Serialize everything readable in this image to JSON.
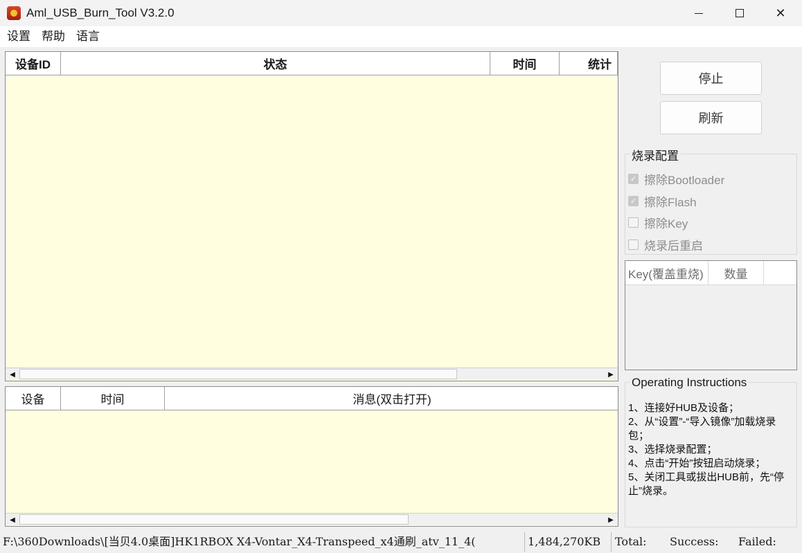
{
  "window": {
    "title": "Aml_USB_Burn_Tool V3.2.0"
  },
  "menu": {
    "items": [
      "设置",
      "帮助",
      "语言"
    ]
  },
  "device_table": {
    "columns": [
      "设备ID",
      "状态",
      "时间",
      "统计"
    ]
  },
  "message_table": {
    "columns": [
      "设备",
      "时间",
      "消息(双击打开)"
    ]
  },
  "buttons": {
    "stop": "停止",
    "refresh": "刷新"
  },
  "burn_config": {
    "title": "烧录配置",
    "options": [
      {
        "label": "擦除Bootloader",
        "checked": true
      },
      {
        "label": "擦除Flash",
        "checked": true
      },
      {
        "label": "擦除Key",
        "checked": false
      },
      {
        "label": "烧录后重启",
        "checked": false
      }
    ]
  },
  "key_table": {
    "columns": [
      "Key(覆盖重烧)",
      "数量"
    ]
  },
  "instructions": {
    "title": "Operating Instructions",
    "text": "1、连接好HUB及设备；\n2、从“设置”-“导入镜像”加载烧录包；\n3、选择烧录配置；\n4、点击“开始”按钮启动烧录；\n5、关闭工具或拔出HUB前，先“停止”烧录。"
  },
  "status": {
    "path": "F:\\360Downloads\\[当贝4.0桌面]HK1RBOX X4-Vontar_X4-Transpeed_x4通刷_atv_11_4(",
    "size": "1,484,270KB",
    "total": "Total:",
    "success": "Success:",
    "failed": "Failed:"
  }
}
